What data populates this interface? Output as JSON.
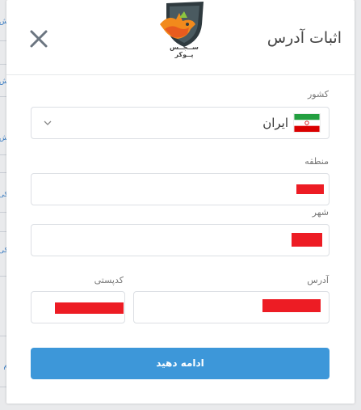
{
  "background": {
    "fragments": [
      "ش",
      "ش",
      "ش",
      "کی",
      "کی",
      "م"
    ]
  },
  "dialog": {
    "title": "اثبات آدرس",
    "close_icon": "close-icon",
    "logo_text": "ســجــس پــوکر",
    "country": {
      "label": "کشور",
      "value": "ایران",
      "chevron_icon": "chevron-down-icon",
      "flag_icon": "iran-flag-icon"
    },
    "region": {
      "label": "منطقه",
      "value": ""
    },
    "city": {
      "label": "شهر",
      "value": ""
    },
    "address": {
      "label": "آدرس",
      "value": ""
    },
    "postal_code": {
      "label": "کدپستی",
      "value": ""
    },
    "submit_label": "ادامه دهید"
  },
  "colors": {
    "accent": "#3d97d9",
    "redaction": "#ed1c24",
    "border": "#dcdfe4"
  }
}
